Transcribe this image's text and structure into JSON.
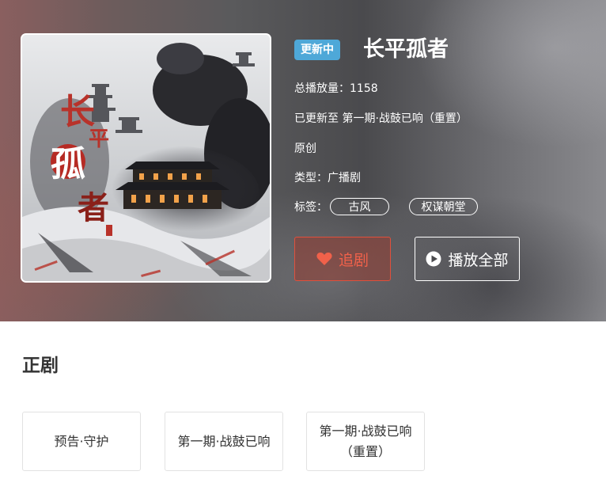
{
  "header": {
    "status_badge": "更新中",
    "title": "长平孤者",
    "play_count": "总播放量：1158",
    "latest": "已更新至 第一期·战鼓已响（重置）",
    "original": "原创",
    "category": "类型：广播剧",
    "tags_label": "标签：",
    "tags": [
      "古风",
      "权谋朝堂"
    ],
    "cover_title_chars": [
      "长",
      "平",
      "孤",
      "者"
    ]
  },
  "actions": {
    "follow_label": "追剧",
    "play_all_label": "播放全部",
    "follow_icon": "heart-icon",
    "play_icon": "play-circle-icon"
  },
  "episodes_section": {
    "title": "正剧",
    "episodes": [
      {
        "label": "预告·守护"
      },
      {
        "label": "第一期·战鼓已响"
      },
      {
        "label": "第一期·战鼓已响（重置）"
      }
    ]
  },
  "colors": {
    "badge": "#4ea8d8",
    "follow_accent": "#e0503c"
  }
}
